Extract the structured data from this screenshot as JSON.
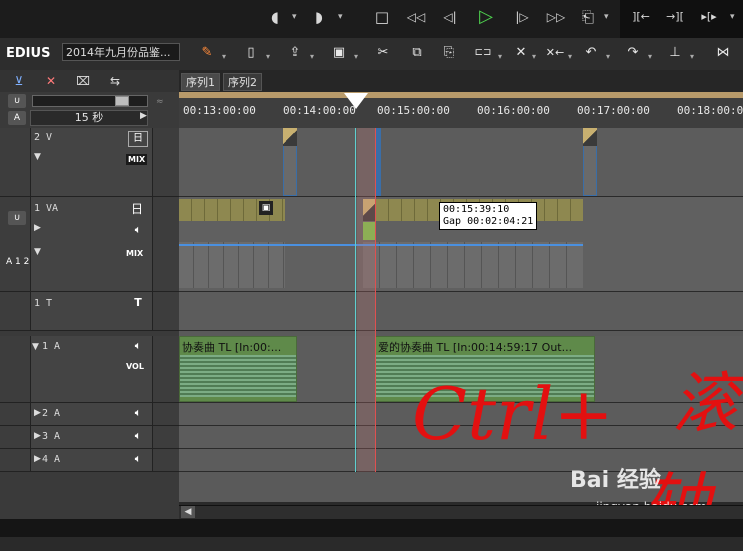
{
  "transport": {
    "buttons": [
      {
        "name": "set-in-icon",
        "glyph": "◖"
      },
      {
        "name": "set-out-icon",
        "glyph": "◗"
      },
      {
        "name": "stop-icon",
        "glyph": "□"
      },
      {
        "name": "rewind-icon",
        "glyph": "◁◁"
      },
      {
        "name": "step-back-icon",
        "glyph": "◁|"
      },
      {
        "name": "play-icon",
        "glyph": "▷"
      },
      {
        "name": "step-forward-icon",
        "glyph": "|▷"
      },
      {
        "name": "fast-forward-icon",
        "glyph": "▷▷"
      },
      {
        "name": "loop-icon",
        "glyph": "⎗"
      },
      {
        "name": "mark-in-icon",
        "glyph": "][←"
      },
      {
        "name": "mark-out-icon",
        "glyph": "→]["
      },
      {
        "name": "trim-icon",
        "glyph": "▸[▸"
      }
    ]
  },
  "toolbar": {
    "logo": "EDIUS",
    "project_name": "2014年九月份品鉴...",
    "tools": [
      {
        "name": "new-sequence-icon",
        "glyph": "✎"
      },
      {
        "name": "new-file-icon",
        "glyph": "▯"
      },
      {
        "name": "import-icon",
        "glyph": "⇪"
      },
      {
        "name": "save-icon",
        "glyph": "▣"
      },
      {
        "name": "cut-icon",
        "glyph": "✂"
      },
      {
        "name": "copy-icon",
        "glyph": "⧉"
      },
      {
        "name": "paste-icon",
        "glyph": "⎘"
      },
      {
        "name": "link-icon",
        "glyph": "⊏⊐"
      },
      {
        "name": "delete-icon",
        "glyph": "✕"
      },
      {
        "name": "ripple-delete-icon",
        "glyph": "✕←"
      },
      {
        "name": "undo-icon",
        "glyph": "↶"
      },
      {
        "name": "redo-icon",
        "glyph": "↷"
      },
      {
        "name": "marker-icon",
        "glyph": "⊥"
      },
      {
        "name": "snap-icon",
        "glyph": "⋈"
      }
    ]
  },
  "header_tools": [
    {
      "name": "insert-mode-icon",
      "glyph": "⊻"
    },
    {
      "name": "ripple-mode-icon",
      "glyph": "✕"
    },
    {
      "name": "sync-mode-icon",
      "glyph": "⌧"
    },
    {
      "name": "group-mode-icon",
      "glyph": "⇆"
    }
  ],
  "zoom": {
    "label": "15 秒"
  },
  "sequence_tabs": [
    "序列1",
    "序列2"
  ],
  "ruler_ticks": [
    "00:13:00:00",
    "00:14:00:00",
    "00:15:00:00",
    "00:16:00:00",
    "00:17:00:00",
    "00:18:00:00"
  ],
  "tracks": [
    {
      "name": "2 V",
      "type": "video"
    },
    {
      "name": "1 VA",
      "type": "videoaudio"
    },
    {
      "name": "1 T",
      "type": "title"
    },
    {
      "name": "1 A",
      "type": "audio"
    },
    {
      "name": "2 A",
      "type": "audio"
    },
    {
      "name": "3 A",
      "type": "audio"
    },
    {
      "name": "4 A",
      "type": "audio"
    }
  ],
  "labels": {
    "mix": "MIX",
    "vol": "VOL",
    "ab12": "A 1 2"
  },
  "tooltip": {
    "line1": "00:15:39:10",
    "line2": "Gap 00:02:04:21"
  },
  "audio_clips": [
    {
      "label": "协奏曲  TL [In:00:..."
    },
    {
      "label": "爱的协奏曲  TL [In:00:14:59:17 Out..."
    }
  ],
  "annotation": {
    "text1": "Ctrl+",
    "text2": "滚",
    "text3": "轴"
  },
  "watermark": {
    "text": "Bai 经验",
    "url": "jingyan.baidu.com"
  },
  "colors": {
    "play": "#4fd44f",
    "annotation": "#e31010",
    "ruler_band": "#b89a6a",
    "playhead": "#ffffff"
  }
}
